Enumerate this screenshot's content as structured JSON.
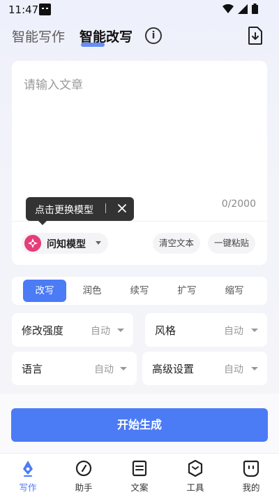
{
  "status_bar": {
    "time": "11:47"
  },
  "header": {
    "tabs": [
      {
        "label": "智能写作",
        "active": false
      },
      {
        "label": "智能改写",
        "active": true
      }
    ]
  },
  "editor": {
    "placeholder": "请输入文章",
    "char_count": "0/2000",
    "model": "问知模型",
    "clear_label": "清空文本",
    "paste_label": "一键粘贴"
  },
  "tooltip": {
    "text": "点击更换模型"
  },
  "modes": [
    {
      "label": "改写",
      "active": true
    },
    {
      "label": "润色",
      "active": false
    },
    {
      "label": "续写",
      "active": false
    },
    {
      "label": "扩写",
      "active": false
    },
    {
      "label": "缩写",
      "active": false
    }
  ],
  "settings": [
    {
      "label": "修改强度",
      "value": "自动"
    },
    {
      "label": "风格",
      "value": "自动"
    },
    {
      "label": "语言",
      "value": "自动"
    },
    {
      "label": "高级设置",
      "value": "自动"
    }
  ],
  "generate_label": "开始生成",
  "nav": [
    {
      "label": "写作",
      "icon": "pen-nib-icon",
      "active": true
    },
    {
      "label": "助手",
      "icon": "compass-icon",
      "active": false
    },
    {
      "label": "文案",
      "icon": "document-icon",
      "active": false
    },
    {
      "label": "工具",
      "icon": "hexagon-tool-icon",
      "active": false
    },
    {
      "label": "我的",
      "icon": "smile-face-icon",
      "active": false
    }
  ],
  "colors": {
    "accent": "#4b7bf5",
    "model_logo": "#e63d79",
    "tooltip_bg": "#333333"
  }
}
